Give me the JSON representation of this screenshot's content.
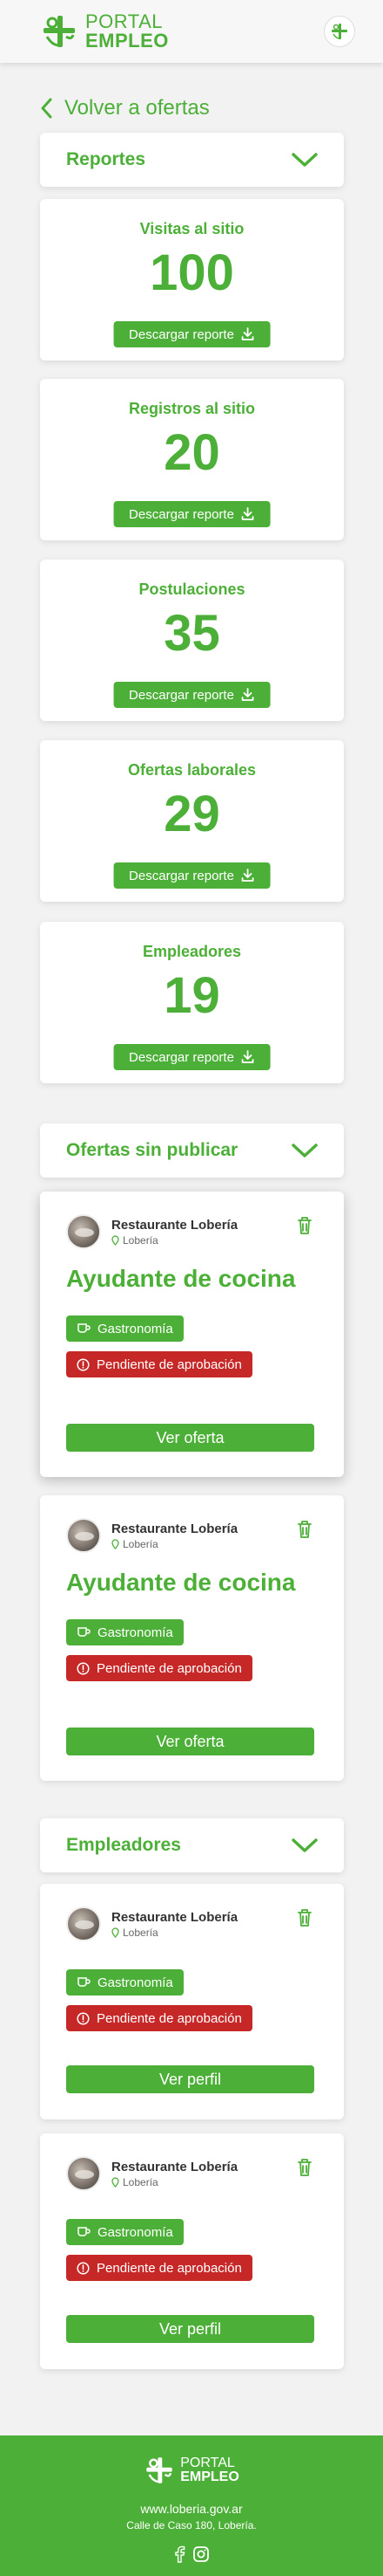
{
  "header": {
    "brand_top": "PORTAL",
    "brand_bottom": "EMPLEO"
  },
  "back_link": "Volver a ofertas",
  "reports": {
    "title": "Reportes",
    "cards": [
      {
        "label": "Visitas al sitio",
        "value": "100",
        "button": "Descargar reporte"
      },
      {
        "label": "Registros al sitio",
        "value": "20",
        "button": "Descargar reporte"
      },
      {
        "label": "Postulaciones",
        "value": "35",
        "button": "Descargar reporte"
      },
      {
        "label": "Ofertas laborales",
        "value": "29",
        "button": "Descargar reporte"
      },
      {
        "label": "Empleadores",
        "value": "19",
        "button": "Descargar reporte"
      }
    ]
  },
  "unpublished": {
    "title": "Ofertas sin publicar",
    "offers": [
      {
        "company": "Restaurante Lobería",
        "location": "Lobería",
        "job_title": "Ayudante de cocina",
        "category": "Gastronomía",
        "status": "Pendiente de aprobación",
        "button": "Ver oferta"
      },
      {
        "company": "Restaurante Lobería",
        "location": "Lobería",
        "job_title": "Ayudante de cocina",
        "category": "Gastronomía",
        "status": "Pendiente de aprobación",
        "button": "Ver oferta"
      }
    ]
  },
  "employers": {
    "title": "Empleadores",
    "items": [
      {
        "company": "Restaurante Lobería",
        "location": "Lobería",
        "category": "Gastronomía",
        "status": "Pendiente de aprobación",
        "button": "Ver perfil"
      },
      {
        "company": "Restaurante Lobería",
        "location": "Lobería",
        "category": "Gastronomía",
        "status": "Pendiente de aprobación",
        "button": "Ver perfil"
      }
    ]
  },
  "footer": {
    "brand_top": "PORTAL",
    "brand_bottom": "EMPLEO",
    "website": "www.loberia.gov.ar",
    "address": "Calle de Caso 180, Lobería."
  },
  "colors": {
    "primary": "#4caf37",
    "danger": "#c62828",
    "background": "#f2f2f2"
  },
  "icons": [
    "portal-empleo-logo-icon",
    "chevron-left-icon",
    "chevron-down-icon",
    "download-icon",
    "trash-icon",
    "location-pin-icon",
    "coffee-cup-icon",
    "alert-circle-icon",
    "facebook-icon",
    "instagram-icon"
  ]
}
